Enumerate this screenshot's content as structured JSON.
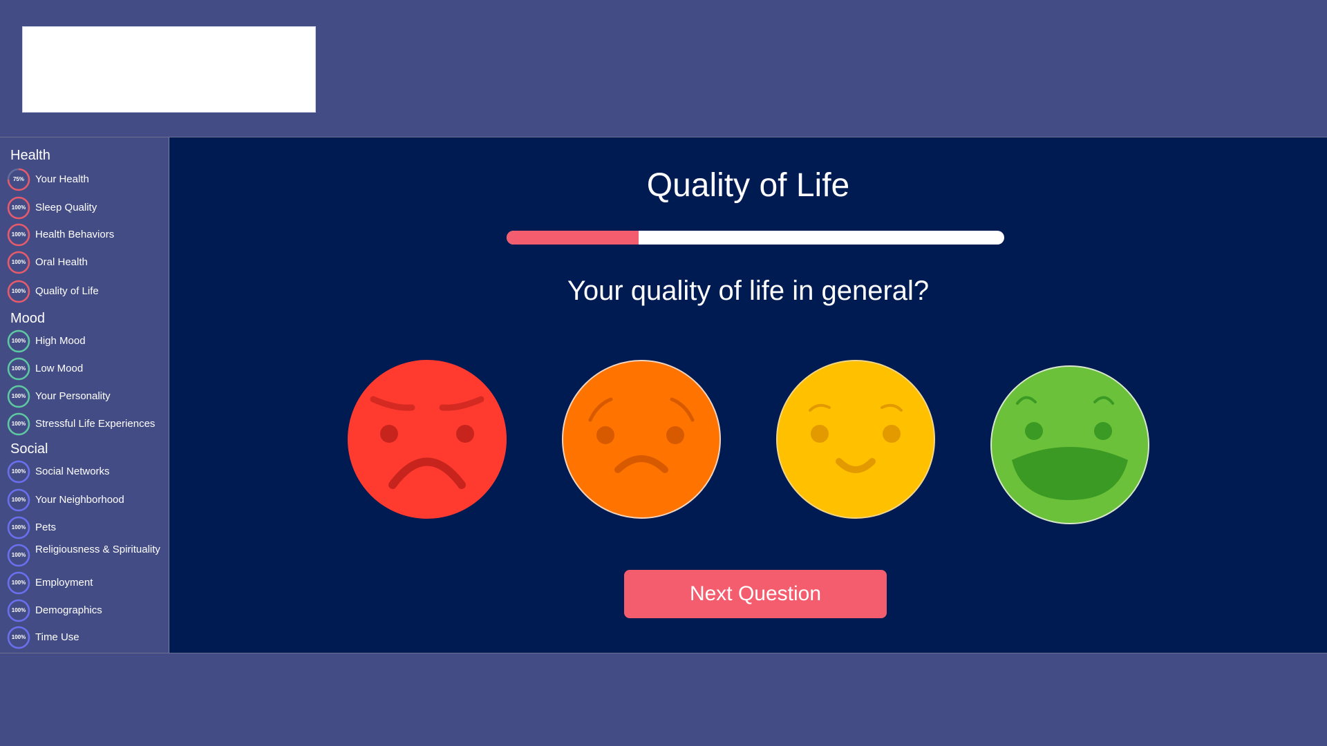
{
  "colors": {
    "header_bg": "#434c85",
    "main_bg": "#001b52",
    "accent": "#f45d6d",
    "health_ring": "#e85a6a",
    "mood_ring": "#5cc9a0",
    "social_ring": "#6a6ff0"
  },
  "sidebar": {
    "sections": [
      {
        "title": "Health",
        "ring_color": "#e85a6a",
        "items": [
          {
            "label": "Your Health",
            "percent": "75%",
            "value": 0.75
          },
          {
            "label": "Sleep Quality",
            "percent": "100%",
            "value": 1
          },
          {
            "label": "Health Behaviors",
            "percent": "100%",
            "value": 1
          },
          {
            "label": "Oral Health",
            "percent": "100%",
            "value": 1
          },
          {
            "label": "Quality of Life",
            "percent": "100%",
            "value": 1
          }
        ]
      },
      {
        "title": "Mood",
        "ring_color": "#5cc9a0",
        "items": [
          {
            "label": "High Mood",
            "percent": "100%",
            "value": 1
          },
          {
            "label": "Low Mood",
            "percent": "100%",
            "value": 1
          },
          {
            "label": "Your Personality",
            "percent": "100%",
            "value": 1
          },
          {
            "label": "Stressful Life Experiences",
            "percent": "100%",
            "value": 1
          }
        ]
      },
      {
        "title": "Social",
        "ring_color": "#6a6ff0",
        "items": [
          {
            "label": "Social Networks",
            "percent": "100%",
            "value": 1
          },
          {
            "label": "Your Neighborhood",
            "percent": "100%",
            "value": 1
          },
          {
            "label": "Pets",
            "percent": "100%",
            "value": 1
          },
          {
            "label": "Religiousness & Spirituality",
            "percent": "100%",
            "value": 1
          },
          {
            "label": "Employment",
            "percent": "100%",
            "value": 1
          },
          {
            "label": "Demographics",
            "percent": "100%",
            "value": 1
          },
          {
            "label": "Time Use",
            "percent": "100%",
            "value": 1
          }
        ]
      }
    ]
  },
  "main": {
    "title": "Quality of Life",
    "progress": 0.265,
    "question": "Your quality of life in general?",
    "faces": [
      {
        "name": "angry-face-icon",
        "color": "#ff3b30"
      },
      {
        "name": "sad-face-icon",
        "color": "#ff7300"
      },
      {
        "name": "smiling-face-icon",
        "color": "#ffc000"
      },
      {
        "name": "laughing-face-icon",
        "color": "#6cc13a"
      }
    ],
    "next_button_label": "Next Question"
  }
}
